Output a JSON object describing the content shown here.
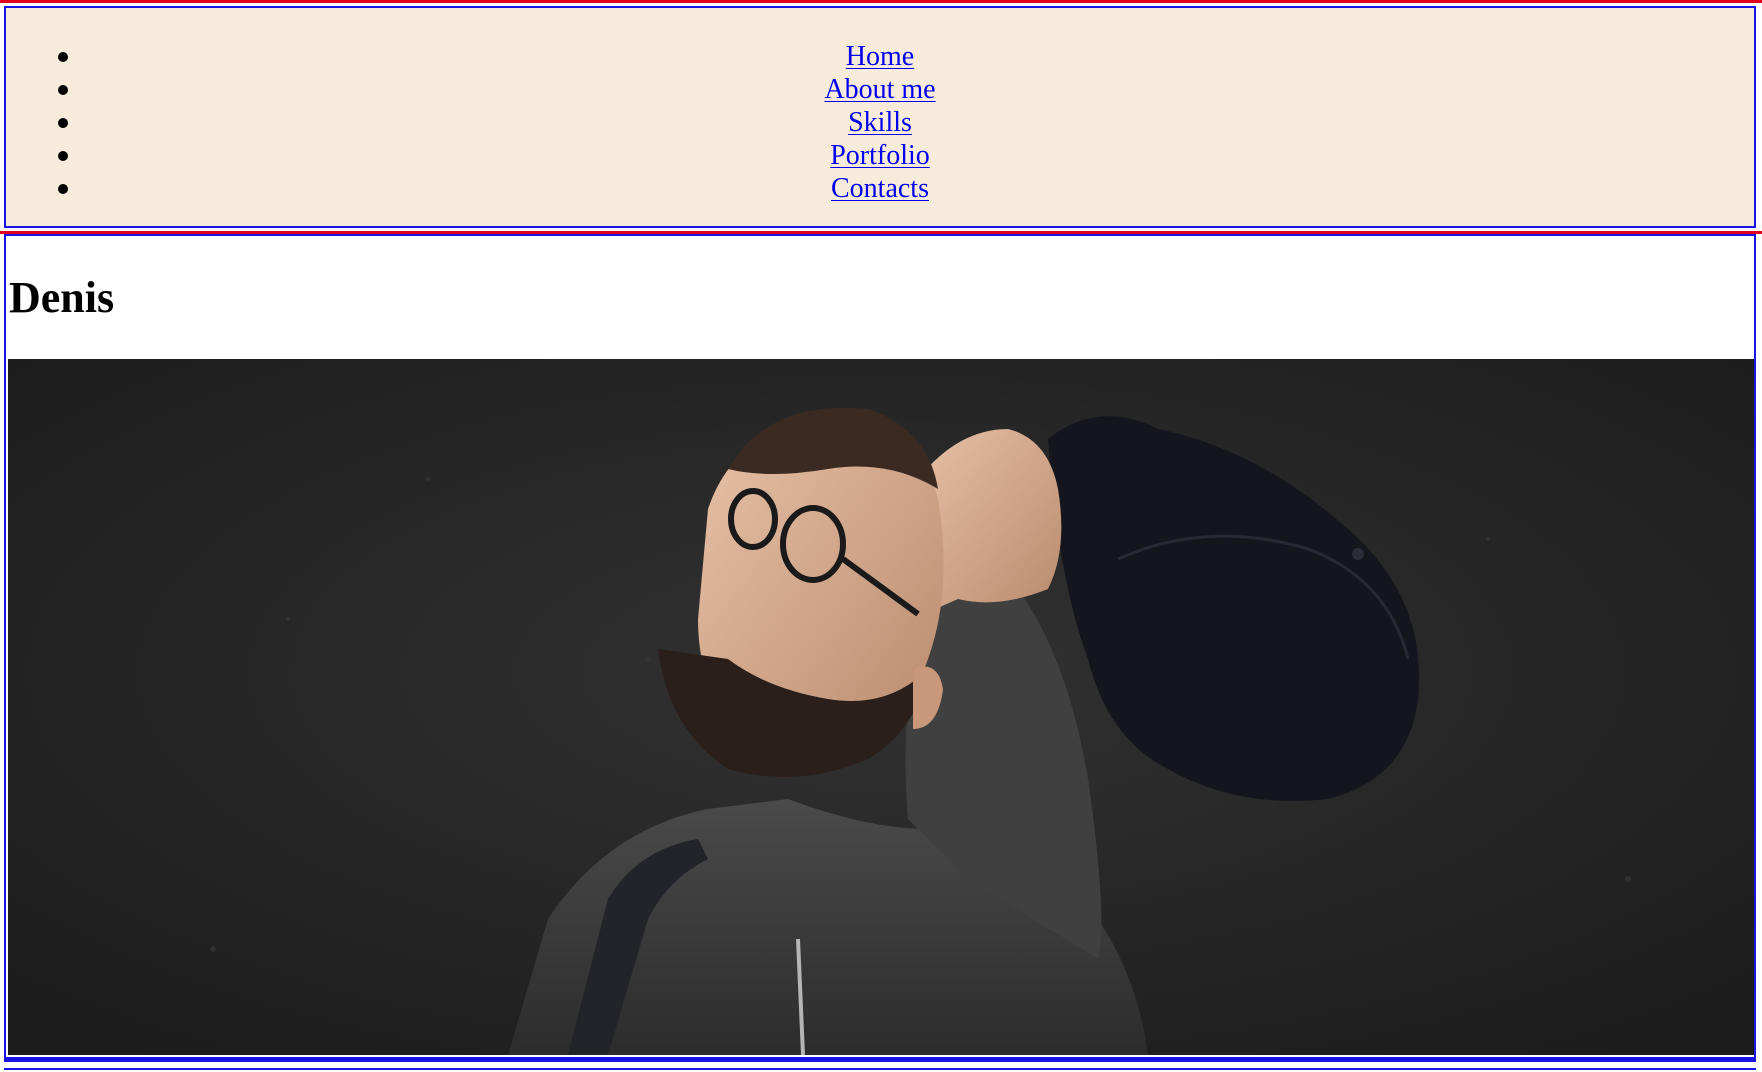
{
  "nav": {
    "items": [
      {
        "label": "Home"
      },
      {
        "label": "About me"
      },
      {
        "label": "Skills"
      },
      {
        "label": "Portfolio"
      },
      {
        "label": "Contacts"
      }
    ]
  },
  "hero": {
    "title": "Denis"
  },
  "colors": {
    "nav_background": "#f7ebdb",
    "outline_red": "#e0001b",
    "outline_blue": "#1a14e6",
    "link": "#0000ee",
    "photo_background": "#262626"
  }
}
